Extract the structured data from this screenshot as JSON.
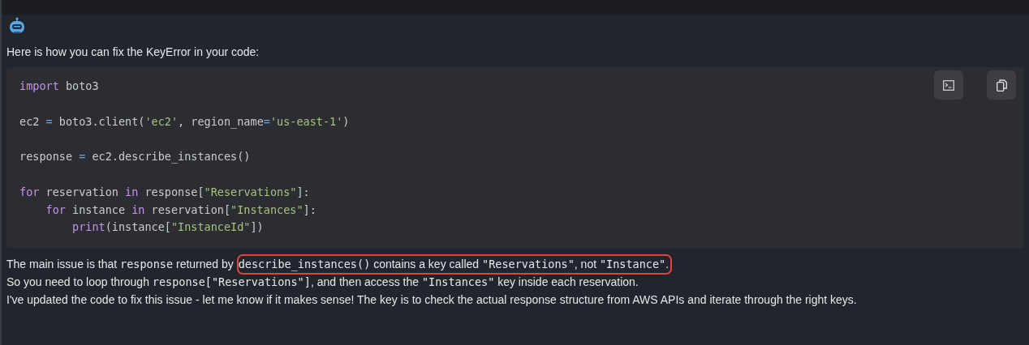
{
  "assistant": {
    "kind": "bot"
  },
  "intro": "Here is how you can fix the KeyError in your code:",
  "code_block": {
    "buttons": [
      {
        "kind": "terminal"
      },
      {
        "kind": "copy"
      }
    ],
    "lines": [
      {
        "kind": "code",
        "tokens": [
          {
            "kind": "kw",
            "text": "import"
          },
          {
            "kind": "plain",
            "text": " boto3"
          }
        ]
      },
      {
        "kind": "blank"
      },
      {
        "kind": "code",
        "tokens": [
          {
            "kind": "plain",
            "text": "ec2 "
          },
          {
            "kind": "op",
            "text": "="
          },
          {
            "kind": "plain",
            "text": " boto3.client("
          },
          {
            "kind": "str",
            "text": "'ec2'"
          },
          {
            "kind": "plain",
            "text": ", region_name"
          },
          {
            "kind": "op",
            "text": "="
          },
          {
            "kind": "str",
            "text": "'us-east-1'"
          },
          {
            "kind": "plain",
            "text": ")"
          }
        ]
      },
      {
        "kind": "blank"
      },
      {
        "kind": "code",
        "tokens": [
          {
            "kind": "plain",
            "text": "response "
          },
          {
            "kind": "op",
            "text": "="
          },
          {
            "kind": "plain",
            "text": " ec2.describe_instances()"
          }
        ]
      },
      {
        "kind": "blank"
      },
      {
        "kind": "code",
        "tokens": [
          {
            "kind": "kw",
            "text": "for"
          },
          {
            "kind": "plain",
            "text": " reservation "
          },
          {
            "kind": "kw",
            "text": "in"
          },
          {
            "kind": "plain",
            "text": " response["
          },
          {
            "kind": "str",
            "text": "\"Reservations\""
          },
          {
            "kind": "plain",
            "text": "]:"
          }
        ],
        "children": [
          {
            "kind": "code",
            "tokens": [
              {
                "kind": "kw",
                "text": "for"
              },
              {
                "kind": "plain",
                "text": " instance "
              },
              {
                "kind": "kw",
                "text": "in"
              },
              {
                "kind": "plain",
                "text": " reservation["
              },
              {
                "kind": "str",
                "text": "\"Instances\""
              },
              {
                "kind": "plain",
                "text": "]:"
              }
            ],
            "children": [
              {
                "kind": "code",
                "tokens": [
                  {
                    "kind": "kw",
                    "text": "print"
                  },
                  {
                    "kind": "plain",
                    "text": "(instance["
                  },
                  {
                    "kind": "str",
                    "text": "\"InstanceId\""
                  },
                  {
                    "kind": "plain",
                    "text": "])"
                  }
                ]
              }
            ]
          }
        ]
      }
    ]
  },
  "paragraphs": [
    {
      "segments": [
        {
          "kind": "text",
          "text": "The main issue is that "
        },
        {
          "kind": "code",
          "text": "response"
        },
        {
          "kind": "text",
          "text": " returned by "
        },
        {
          "kind": "highlight",
          "segments": [
            {
              "kind": "code",
              "text": "describe_instances()"
            },
            {
              "kind": "text",
              "text": " contains a key called "
            },
            {
              "kind": "code",
              "text": "\"Reservations\""
            },
            {
              "kind": "text",
              "text": ", not "
            },
            {
              "kind": "code",
              "text": "\"Instance\""
            },
            {
              "kind": "text",
              "text": "."
            }
          ]
        }
      ]
    },
    {
      "segments": [
        {
          "kind": "text",
          "text": "So you need to loop through "
        },
        {
          "kind": "code",
          "text": "response[\"Reservations\"]"
        },
        {
          "kind": "text",
          "text": ", and then access the "
        },
        {
          "kind": "code",
          "text": "\"Instances\""
        },
        {
          "kind": "text",
          "text": " key inside each reservation."
        }
      ]
    },
    {
      "segments": [
        {
          "kind": "text",
          "text": "I've updated the code to fix this issue - let me know if it makes sense! The key is to check the actual response structure from AWS APIs and iterate through the right keys."
        }
      ]
    }
  ]
}
